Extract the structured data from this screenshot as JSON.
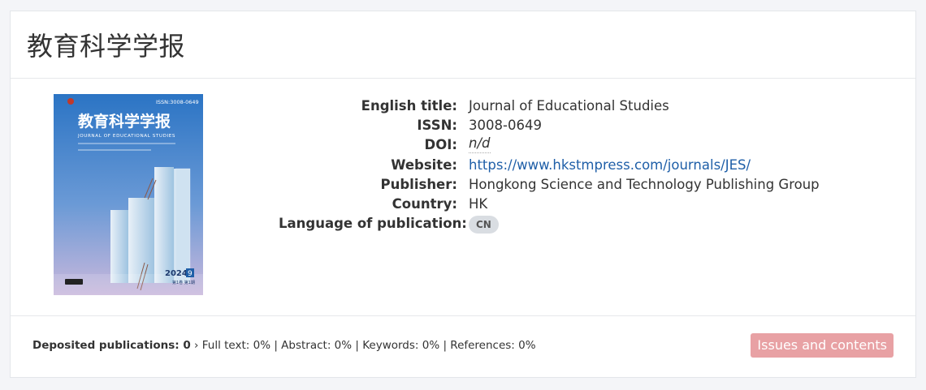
{
  "journal": {
    "title": "教育科学学报"
  },
  "cover": {
    "issn_label": "ISSN:3008-0649",
    "title_cn": "教育科学学报",
    "title_en": "JOURNAL OF EDUCATIONAL STUDIES",
    "year": "2024",
    "issue_no": "9",
    "volume_line": "第1卷 第1期",
    "bg_top": "#2f79c7",
    "bg_bottom": "#b7c7e6"
  },
  "details": [
    {
      "label": "English title:",
      "value": "Journal of Educational Studies"
    },
    {
      "label": "ISSN:",
      "value": "3008-0649"
    },
    {
      "label": "DOI:",
      "value": "n/d"
    },
    {
      "label": "Website:",
      "value": "https://www.hkstmpress.com/journals/JES/"
    },
    {
      "label": "Publisher:",
      "value": "Hongkong Science and Technology Publishing Group"
    },
    {
      "label": "Country:",
      "value": "HK"
    },
    {
      "label": "Language of publication:",
      "value": "CN"
    }
  ],
  "footer": {
    "deposited_label": "Deposited publications: 0",
    "separator": "›",
    "stats_text": "Full text: 0% | Abstract: 0% | Keywords: 0% | References: 0%",
    "issues_button": "Issues and contents",
    "issues_button_color": "#e8a1a4"
  },
  "colors": {
    "link": "#1f5fa8",
    "badge_bg": "#d9dde2"
  }
}
